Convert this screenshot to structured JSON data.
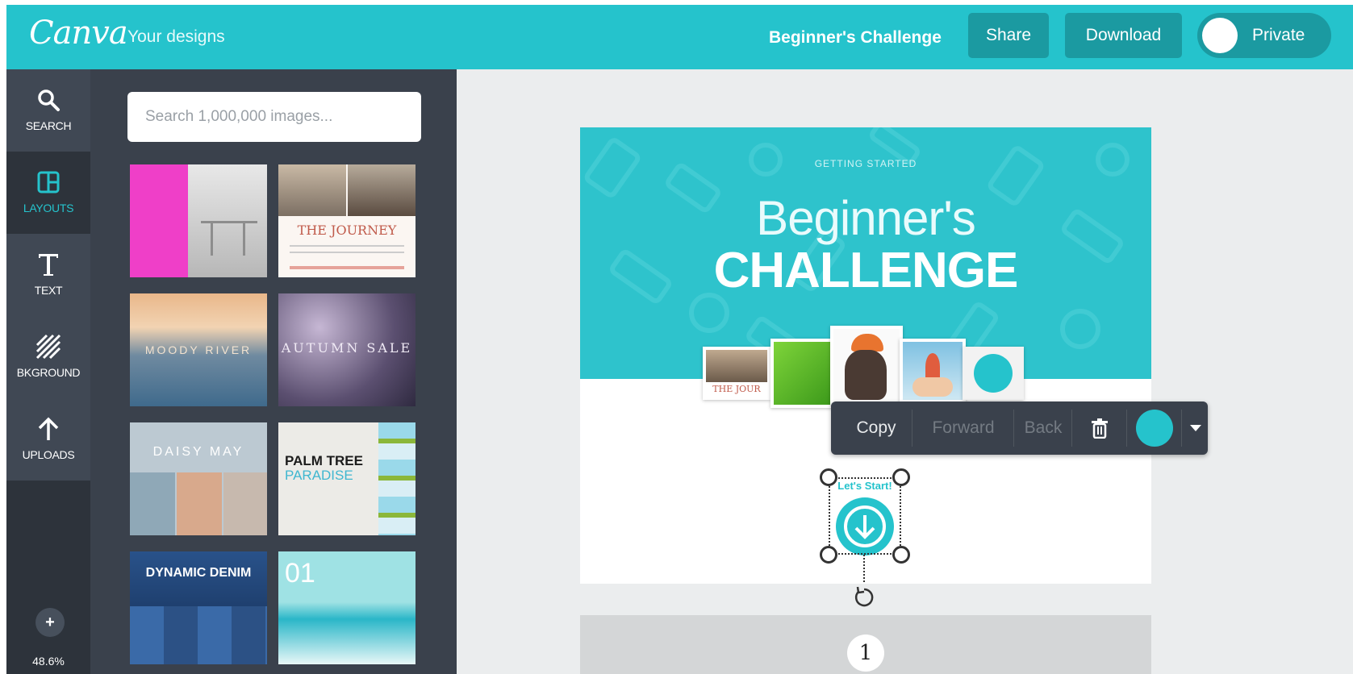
{
  "header": {
    "logo": "Canva",
    "your_designs": "Your designs",
    "doc_title": "Beginner's Challenge",
    "share": "Share",
    "download": "Download",
    "privacy": "Private"
  },
  "rail": {
    "items": [
      {
        "label": "SEARCH",
        "icon": "search-icon"
      },
      {
        "label": "LAYOUTS",
        "icon": "layouts-icon"
      },
      {
        "label": "TEXT",
        "icon": "text-icon"
      },
      {
        "label": "BKGROUND",
        "icon": "background-icon"
      },
      {
        "label": "UPLOADS",
        "icon": "upload-icon"
      }
    ],
    "add": "+",
    "zoom": "48.6%"
  },
  "panel": {
    "search_placeholder": "Search 1,000,000 images...",
    "layouts": [
      {
        "text": "",
        "sub": ""
      },
      {
        "text": "THE JOURNEY",
        "sub": ""
      },
      {
        "text": "MOODY RIVER",
        "sub": ""
      },
      {
        "text": "AUTUMN SALE",
        "sub": ""
      },
      {
        "text": "DAISY MAY",
        "sub": ""
      },
      {
        "text": "PALM TREE",
        "sub": "PARADISE"
      },
      {
        "text": "DYNAMIC DENIM",
        "sub": ""
      },
      {
        "text": "01",
        "sub": ""
      }
    ]
  },
  "canvas": {
    "kicker": "GETTING STARTED",
    "headline_light": "Beginner's",
    "headline_bold": "CHALLENGE",
    "photo_caption": "THE JOUR",
    "element_label": "Let's Start!",
    "page_number": "1"
  },
  "context_toolbar": {
    "copy": "Copy",
    "forward": "Forward",
    "back": "Back"
  },
  "colors": {
    "brand": "#25c3cc",
    "topbar_button": "#1b9aa1",
    "rail": "#2d333b",
    "panel": "#3a414c"
  }
}
